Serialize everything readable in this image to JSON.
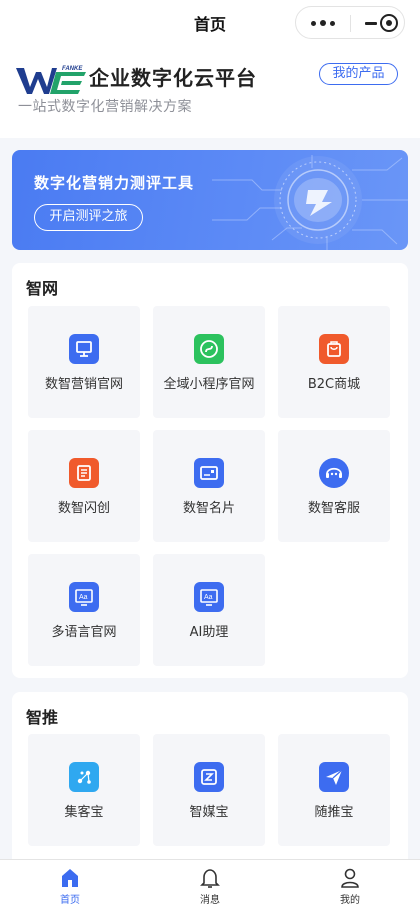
{
  "topbar": {
    "title": "首页"
  },
  "header": {
    "logo_text": "FANKE",
    "brand": "企业数字化云平台",
    "slogan": "一站式数字化营销解决方案",
    "products_button": "我的产品"
  },
  "banner": {
    "title": "数字化营销力测评工具",
    "button": "开启测评之旅"
  },
  "sections": [
    {
      "title": "智网",
      "items": [
        {
          "label": "数智营销官网",
          "icon": "monitor-icon",
          "color": "#3d6cf0"
        },
        {
          "label": "全域小程序官网",
          "icon": "mini-program-icon",
          "color": "#2cc25e"
        },
        {
          "label": "B2C商城",
          "icon": "shopping-bag-icon",
          "color": "#f05a2c"
        },
        {
          "label": "数智闪创",
          "icon": "document-icon",
          "color": "#f05a2c"
        },
        {
          "label": "数智名片",
          "icon": "id-card-icon",
          "color": "#3d6cf0"
        },
        {
          "label": "数智客服",
          "icon": "chat-bot-icon",
          "color": "#3d6cf0"
        },
        {
          "label": "多语言官网",
          "icon": "language-icon",
          "color": "#3d6cf0"
        },
        {
          "label": "AI助理",
          "icon": "ai-assistant-icon",
          "color": "#3d6cf0"
        }
      ]
    },
    {
      "title": "智推",
      "items": [
        {
          "label": "集客宝",
          "icon": "share-nodes-icon",
          "color": "#2fa8f0"
        },
        {
          "label": "智媒宝",
          "icon": "media-z-icon",
          "color": "#3d6cf0"
        },
        {
          "label": "随推宝",
          "icon": "paper-plane-icon",
          "color": "#3d6cf0"
        }
      ]
    }
  ],
  "tabbar": [
    {
      "label": "首页",
      "icon": "home-icon",
      "active": true
    },
    {
      "label": "消息",
      "icon": "bell-icon",
      "active": false
    },
    {
      "label": "我的",
      "icon": "user-icon",
      "active": false
    }
  ],
  "colors": {
    "accent": "#3d6cf0",
    "banner": "#5d8bf6",
    "card_bg": "#f5f6f9",
    "page_bg": "#f4f6fa"
  }
}
